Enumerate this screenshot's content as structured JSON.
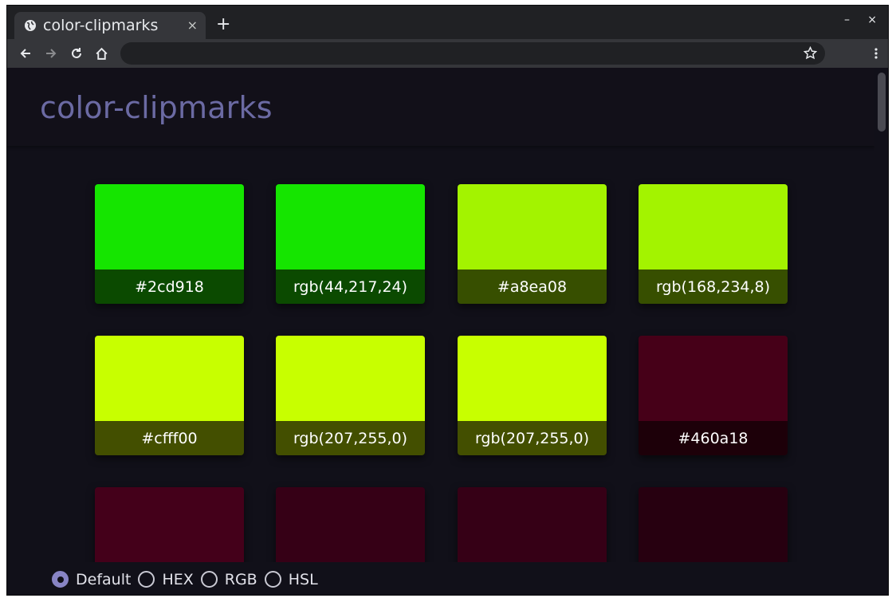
{
  "browser": {
    "tab_title": "color-clipmarks",
    "tab_close": "×",
    "new_tab": "+",
    "minimize": "–",
    "close": "×",
    "omnibox_value": ""
  },
  "page": {
    "title": "color-clipmarks"
  },
  "cards": [
    {
      "label": "#2cd918",
      "color": "#15e500",
      "label_bg": "#0b4a00"
    },
    {
      "label": "rgb(44,217,24)",
      "color": "#15e500",
      "label_bg": "#0b4a00"
    },
    {
      "label": "#a8ea08",
      "color": "#a3f300",
      "label_bg": "#374f00"
    },
    {
      "label": "rgb(168,234,8)",
      "color": "#a3f300",
      "label_bg": "#374f00"
    },
    {
      "label": "#cfff00",
      "color": "#c8ff00",
      "label_bg": "#434f00"
    },
    {
      "label": "rgb(207,255,0)",
      "color": "#c8ff00",
      "label_bg": "#434f00"
    },
    {
      "label": "rgb(207,255,0)",
      "color": "#c8ff00",
      "label_bg": "#434f00"
    },
    {
      "label": "#460a18",
      "color": "#460018",
      "label_bg": "#1d0009"
    },
    {
      "label": "",
      "color": "#44001a",
      "label_bg": "#44001a"
    },
    {
      "label": "",
      "color": "#360016",
      "label_bg": "#360016"
    },
    {
      "label": "",
      "color": "#360016",
      "label_bg": "#360016"
    },
    {
      "label": "",
      "color": "#270010",
      "label_bg": "#270010"
    }
  ],
  "format_options": [
    {
      "label": "Default",
      "selected": true
    },
    {
      "label": "HEX",
      "selected": false
    },
    {
      "label": "RGB",
      "selected": false
    },
    {
      "label": "HSL",
      "selected": false
    }
  ],
  "colors": {
    "accent": "#8884c4",
    "title": "#6b6aa3",
    "background": "#111019"
  }
}
